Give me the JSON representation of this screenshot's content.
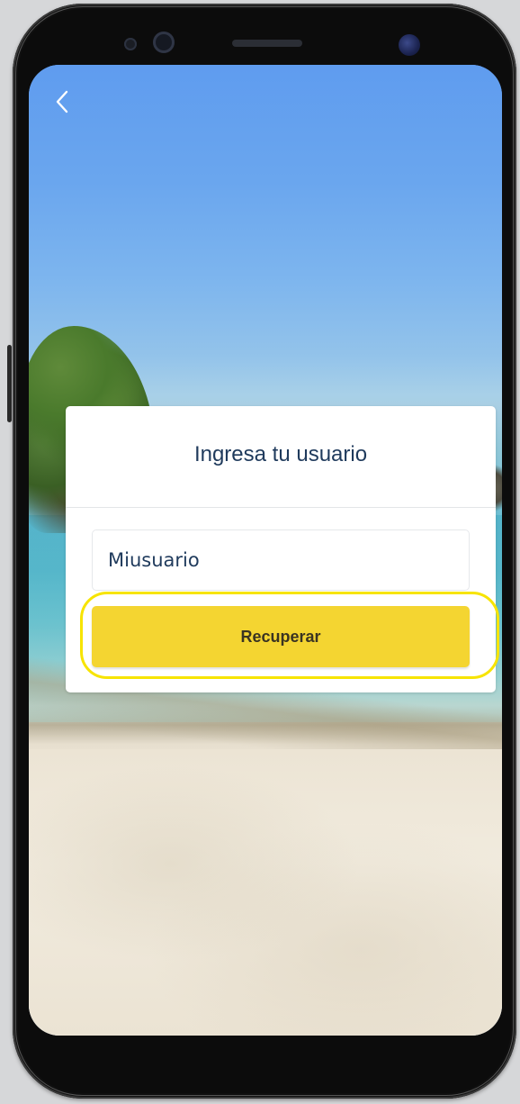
{
  "nav": {
    "back_icon": "chevron-left-icon"
  },
  "form": {
    "title": "Ingresa tu usuario",
    "username_value": "Miusuario",
    "submit_label": "Recuperar"
  },
  "colors": {
    "button_yellow": "#f4d531",
    "highlight_ring": "#f7e400",
    "title_text": "#1f3a5c"
  }
}
